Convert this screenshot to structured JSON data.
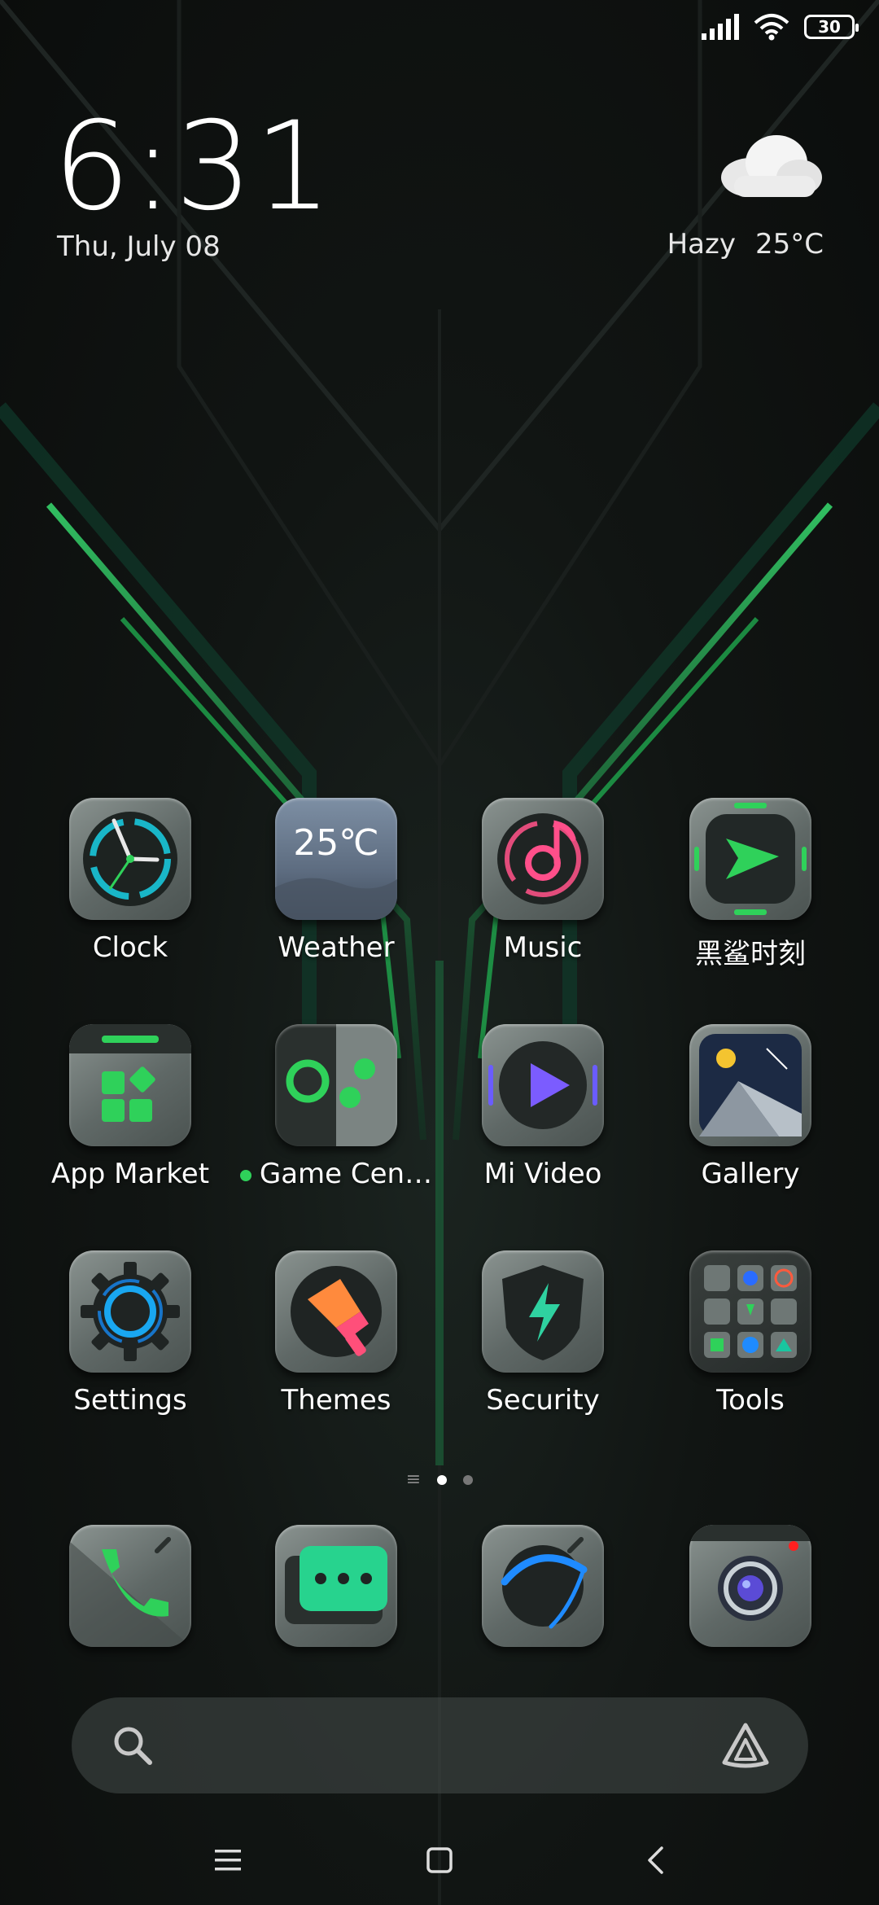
{
  "status_bar": {
    "battery": "30"
  },
  "clock": {
    "time": "6:31",
    "date": "Thu, July 08"
  },
  "weather": {
    "condition": "Hazy",
    "temperature": "25°C",
    "icon": "cloud-icon"
  },
  "apps": [
    {
      "label": "Clock",
      "icon": "clock-icon"
    },
    {
      "label": "Weather",
      "icon": "weather-app-icon",
      "tile_text": "25℃"
    },
    {
      "label": "Music",
      "icon": "music-icon"
    },
    {
      "label": "黑鲨时刻",
      "icon": "blackshark-moments-icon"
    },
    {
      "label": "App Market",
      "icon": "app-market-icon"
    },
    {
      "label": "Game Cen…",
      "icon": "game-center-icon",
      "new_badge": true
    },
    {
      "label": "Mi Video",
      "icon": "video-play-icon"
    },
    {
      "label": "Gallery",
      "icon": "gallery-icon"
    },
    {
      "label": "Settings",
      "icon": "gear-icon"
    },
    {
      "label": "Themes",
      "icon": "themes-brush-icon"
    },
    {
      "label": "Security",
      "icon": "security-shield-icon"
    },
    {
      "label": "Tools",
      "icon": "tools-folder-icon"
    }
  ],
  "page_indicator": {
    "pages": 2,
    "active": 1
  },
  "dock": [
    {
      "icon": "phone-icon"
    },
    {
      "icon": "messages-icon"
    },
    {
      "icon": "browser-icon"
    },
    {
      "icon": "camera-icon"
    }
  ],
  "colors": {
    "accent": "#2fd15a",
    "icon_base": "#6b7472",
    "search_bar": "#464c4a"
  }
}
